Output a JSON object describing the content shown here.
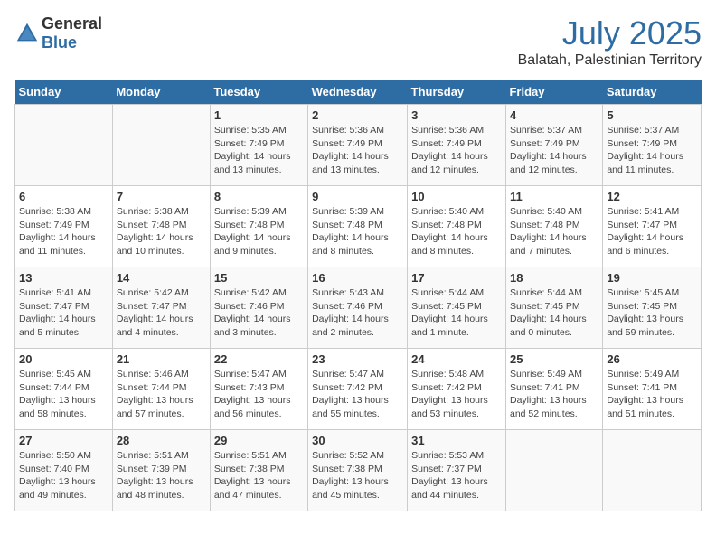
{
  "header": {
    "logo_general": "General",
    "logo_blue": "Blue",
    "month_year": "July 2025",
    "location": "Balatah, Palestinian Territory"
  },
  "days_of_week": [
    "Sunday",
    "Monday",
    "Tuesday",
    "Wednesday",
    "Thursday",
    "Friday",
    "Saturday"
  ],
  "weeks": [
    [
      {
        "day": "",
        "info": ""
      },
      {
        "day": "",
        "info": ""
      },
      {
        "day": "1",
        "info": "Sunrise: 5:35 AM\nSunset: 7:49 PM\nDaylight: 14 hours and 13 minutes."
      },
      {
        "day": "2",
        "info": "Sunrise: 5:36 AM\nSunset: 7:49 PM\nDaylight: 14 hours and 13 minutes."
      },
      {
        "day": "3",
        "info": "Sunrise: 5:36 AM\nSunset: 7:49 PM\nDaylight: 14 hours and 12 minutes."
      },
      {
        "day": "4",
        "info": "Sunrise: 5:37 AM\nSunset: 7:49 PM\nDaylight: 14 hours and 12 minutes."
      },
      {
        "day": "5",
        "info": "Sunrise: 5:37 AM\nSunset: 7:49 PM\nDaylight: 14 hours and 11 minutes."
      }
    ],
    [
      {
        "day": "6",
        "info": "Sunrise: 5:38 AM\nSunset: 7:49 PM\nDaylight: 14 hours and 11 minutes."
      },
      {
        "day": "7",
        "info": "Sunrise: 5:38 AM\nSunset: 7:48 PM\nDaylight: 14 hours and 10 minutes."
      },
      {
        "day": "8",
        "info": "Sunrise: 5:39 AM\nSunset: 7:48 PM\nDaylight: 14 hours and 9 minutes."
      },
      {
        "day": "9",
        "info": "Sunrise: 5:39 AM\nSunset: 7:48 PM\nDaylight: 14 hours and 8 minutes."
      },
      {
        "day": "10",
        "info": "Sunrise: 5:40 AM\nSunset: 7:48 PM\nDaylight: 14 hours and 8 minutes."
      },
      {
        "day": "11",
        "info": "Sunrise: 5:40 AM\nSunset: 7:48 PM\nDaylight: 14 hours and 7 minutes."
      },
      {
        "day": "12",
        "info": "Sunrise: 5:41 AM\nSunset: 7:47 PM\nDaylight: 14 hours and 6 minutes."
      }
    ],
    [
      {
        "day": "13",
        "info": "Sunrise: 5:41 AM\nSunset: 7:47 PM\nDaylight: 14 hours and 5 minutes."
      },
      {
        "day": "14",
        "info": "Sunrise: 5:42 AM\nSunset: 7:47 PM\nDaylight: 14 hours and 4 minutes."
      },
      {
        "day": "15",
        "info": "Sunrise: 5:42 AM\nSunset: 7:46 PM\nDaylight: 14 hours and 3 minutes."
      },
      {
        "day": "16",
        "info": "Sunrise: 5:43 AM\nSunset: 7:46 PM\nDaylight: 14 hours and 2 minutes."
      },
      {
        "day": "17",
        "info": "Sunrise: 5:44 AM\nSunset: 7:45 PM\nDaylight: 14 hours and 1 minute."
      },
      {
        "day": "18",
        "info": "Sunrise: 5:44 AM\nSunset: 7:45 PM\nDaylight: 14 hours and 0 minutes."
      },
      {
        "day": "19",
        "info": "Sunrise: 5:45 AM\nSunset: 7:45 PM\nDaylight: 13 hours and 59 minutes."
      }
    ],
    [
      {
        "day": "20",
        "info": "Sunrise: 5:45 AM\nSunset: 7:44 PM\nDaylight: 13 hours and 58 minutes."
      },
      {
        "day": "21",
        "info": "Sunrise: 5:46 AM\nSunset: 7:44 PM\nDaylight: 13 hours and 57 minutes."
      },
      {
        "day": "22",
        "info": "Sunrise: 5:47 AM\nSunset: 7:43 PM\nDaylight: 13 hours and 56 minutes."
      },
      {
        "day": "23",
        "info": "Sunrise: 5:47 AM\nSunset: 7:42 PM\nDaylight: 13 hours and 55 minutes."
      },
      {
        "day": "24",
        "info": "Sunrise: 5:48 AM\nSunset: 7:42 PM\nDaylight: 13 hours and 53 minutes."
      },
      {
        "day": "25",
        "info": "Sunrise: 5:49 AM\nSunset: 7:41 PM\nDaylight: 13 hours and 52 minutes."
      },
      {
        "day": "26",
        "info": "Sunrise: 5:49 AM\nSunset: 7:41 PM\nDaylight: 13 hours and 51 minutes."
      }
    ],
    [
      {
        "day": "27",
        "info": "Sunrise: 5:50 AM\nSunset: 7:40 PM\nDaylight: 13 hours and 49 minutes."
      },
      {
        "day": "28",
        "info": "Sunrise: 5:51 AM\nSunset: 7:39 PM\nDaylight: 13 hours and 48 minutes."
      },
      {
        "day": "29",
        "info": "Sunrise: 5:51 AM\nSunset: 7:38 PM\nDaylight: 13 hours and 47 minutes."
      },
      {
        "day": "30",
        "info": "Sunrise: 5:52 AM\nSunset: 7:38 PM\nDaylight: 13 hours and 45 minutes."
      },
      {
        "day": "31",
        "info": "Sunrise: 5:53 AM\nSunset: 7:37 PM\nDaylight: 13 hours and 44 minutes."
      },
      {
        "day": "",
        "info": ""
      },
      {
        "day": "",
        "info": ""
      }
    ]
  ]
}
